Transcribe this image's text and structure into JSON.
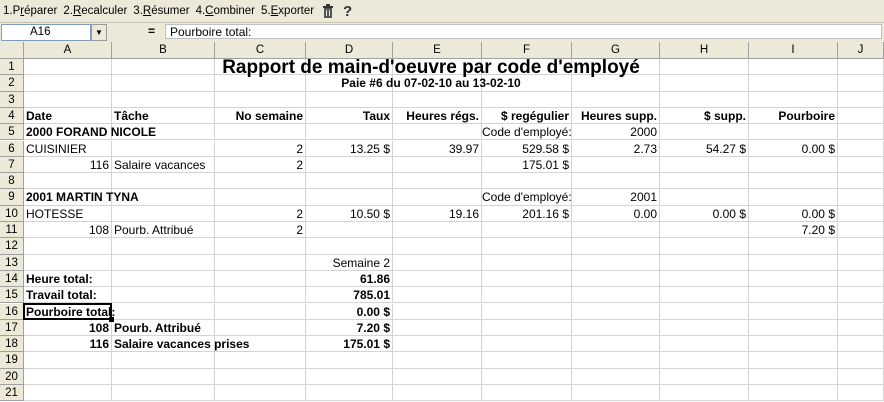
{
  "toolbar": {
    "items": [
      {
        "num": "1.",
        "pre": "P",
        "ul": "r",
        "post": "éparer"
      },
      {
        "num": "2.",
        "pre": "",
        "ul": "R",
        "post": "ecalculer"
      },
      {
        "num": "3.",
        "pre": "",
        "ul": "R",
        "post": "ésumer"
      },
      {
        "num": "4.",
        "pre": "",
        "ul": "C",
        "post": "ombiner"
      },
      {
        "num": "5.",
        "pre": "",
        "ul": "E",
        "post": "xporter"
      }
    ],
    "icons": [
      "trash-icon",
      "help-icon"
    ]
  },
  "formula": {
    "cell_ref": "A16",
    "equals": "=",
    "content": "Pourboire total:"
  },
  "columns": [
    "A",
    "B",
    "C",
    "D",
    "E",
    "F",
    "G",
    "H",
    "I",
    "J"
  ],
  "rows": [
    "1",
    "2",
    "3",
    "4",
    "5",
    "6",
    "7",
    "8",
    "9",
    "10",
    "11",
    "12",
    "13",
    "14",
    "15",
    "16",
    "17",
    "18",
    "19",
    "20",
    "21"
  ],
  "cells": {
    "title": "Rapport de main-d'oeuvre par code d'employé",
    "subtitle": "Paie #6  du 07-02-10  au 13-02-10",
    "r4": {
      "A": "Date",
      "B": "Tâche",
      "C": "No semaine",
      "D": "Taux",
      "E": "Heures régs.",
      "F": "$ regégulier",
      "G": "Heures supp.",
      "H": "$ supp.",
      "I": "Pourboire"
    },
    "r5": {
      "A": "2000 FORAND  NICOLE",
      "F": "Code d'employé:",
      "G": "2000"
    },
    "r6": {
      "A": "CUISINIER",
      "C": "2",
      "D": "13.25 $",
      "E": "39.97",
      "F": "529.58 $",
      "G": "2.73",
      "H": "54.27 $",
      "I": "0.00 $"
    },
    "r7": {
      "A": "116",
      "B": "Salaire vacances",
      "C": "2",
      "F": "175.01 $"
    },
    "r9": {
      "A": "2001 MARTIN  TYNA",
      "F": "Code d'employé:",
      "G": "2001"
    },
    "r10": {
      "A": "HOTESSE",
      "C": "2",
      "D": "10.50 $",
      "E": "19.16",
      "F": "201.16 $",
      "G": "0.00",
      "H": "0.00 $",
      "I": "0.00 $"
    },
    "r11": {
      "A": "108",
      "B": "Pourb. Attribué",
      "C": "2",
      "I": "7.20 $"
    },
    "r13": {
      "D": "Semaine 2"
    },
    "r14": {
      "A": "Heure total:",
      "D": "61.86"
    },
    "r15": {
      "A": "Travail total:",
      "D": "785.01"
    },
    "r16": {
      "A": "Pourboire total:",
      "D": "0.00 $"
    },
    "r17": {
      "A": "108",
      "B": "Pourb. Attribué",
      "D": "7.20 $"
    },
    "r18": {
      "A": "116",
      "B": "Salaire vacances prises",
      "D": "175.01 $"
    }
  }
}
